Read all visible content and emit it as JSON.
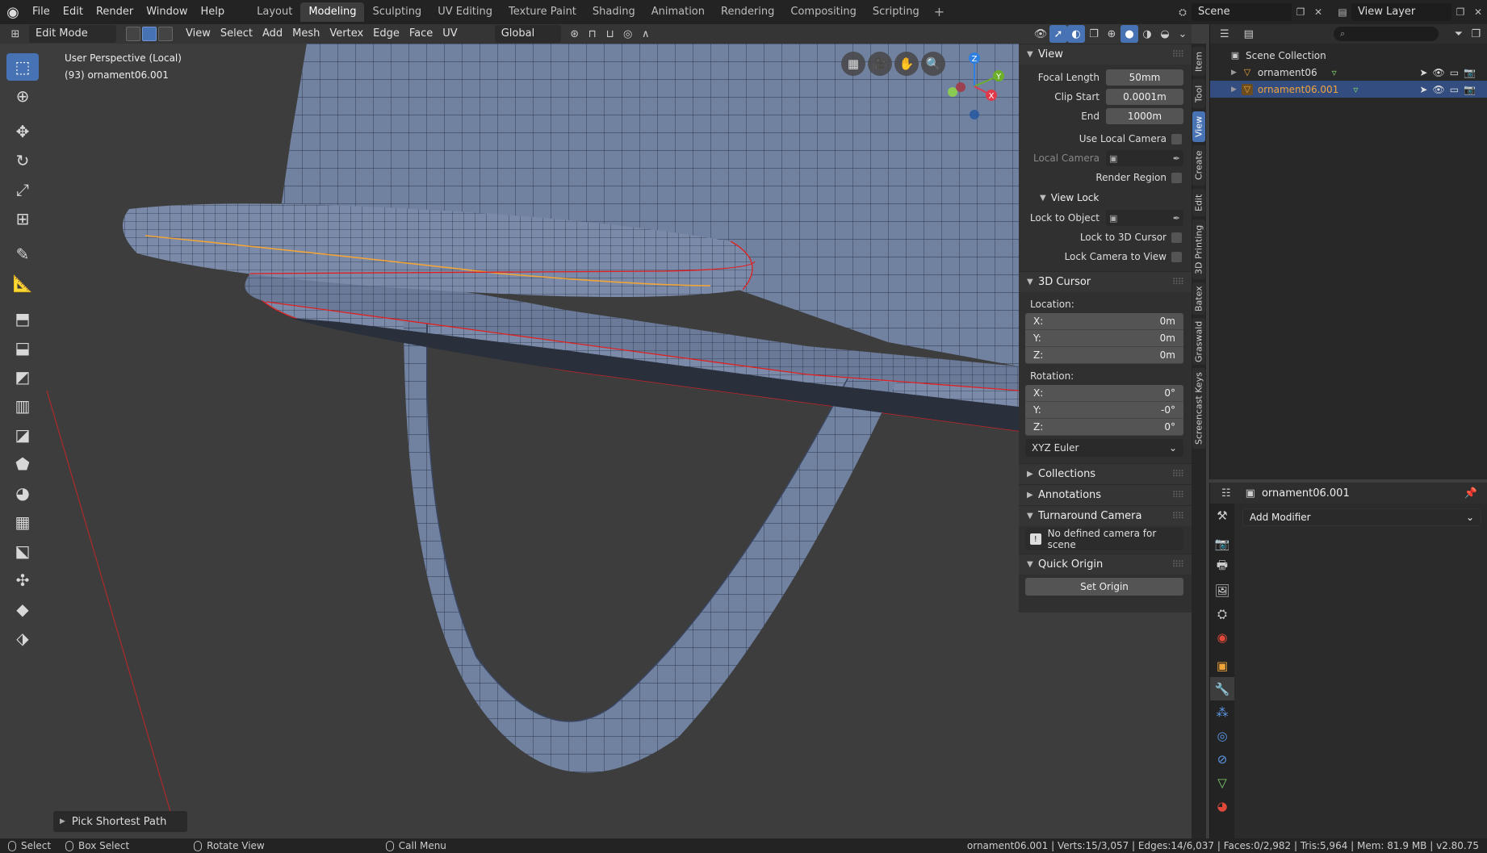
{
  "menus": [
    "File",
    "Edit",
    "Render",
    "Window",
    "Help"
  ],
  "workspaces": [
    "Layout",
    "Modeling",
    "Sculpting",
    "UV Editing",
    "Texture Paint",
    "Shading",
    "Animation",
    "Rendering",
    "Compositing",
    "Scripting"
  ],
  "active_workspace": "Modeling",
  "scene": "Scene",
  "view_layer": "View Layer",
  "header": {
    "mode": "Edit Mode",
    "menus": [
      "View",
      "Select",
      "Add",
      "Mesh",
      "Vertex",
      "Edge",
      "Face",
      "UV"
    ],
    "transform_orientation": "Global"
  },
  "viewport": {
    "perspective": "User Perspective (Local)",
    "object_info": "(93) ornament06.001",
    "last_operator": "Pick Shortest Path"
  },
  "gizmo": {
    "x": "X",
    "y": "Y",
    "z": "Z"
  },
  "npanel": {
    "view": {
      "title": "View",
      "focal_length_label": "Focal Length",
      "focal_length": "50mm",
      "clip_start_label": "Clip Start",
      "clip_start": "0.0001m",
      "end_label": "End",
      "end": "1000m",
      "use_local_camera": "Use Local Camera",
      "local_camera": "Local Camera",
      "render_region": "Render Region",
      "view_lock": "View Lock",
      "lock_to_object": "Lock to Object",
      "lock_to_3d_cursor": "Lock to 3D Cursor",
      "lock_camera_to_view": "Lock Camera to View"
    },
    "cursor": {
      "title": "3D Cursor",
      "location_label": "Location:",
      "loc": [
        {
          "axis": "X:",
          "value": "0m"
        },
        {
          "axis": "Y:",
          "value": "0m"
        },
        {
          "axis": "Z:",
          "value": "0m"
        }
      ],
      "rotation_label": "Rotation:",
      "rot": [
        {
          "axis": "X:",
          "value": "0°"
        },
        {
          "axis": "Y:",
          "value": "-0°"
        },
        {
          "axis": "Z:",
          "value": "0°"
        }
      ],
      "rotation_mode": "XYZ Euler"
    },
    "collections": "Collections",
    "annotations": "Annotations",
    "turnaround": {
      "title": "Turnaround Camera",
      "message": "No defined camera for scene"
    },
    "quick_origin": {
      "title": "Quick Origin",
      "button": "Set Origin"
    }
  },
  "side_tabs": [
    "Item",
    "Tool",
    "View",
    "Create",
    "Edit",
    "3D Printing",
    "Batex",
    "Graswald",
    "Screencast Keys"
  ],
  "active_side_tab": "View",
  "outliner": {
    "root": "Scene Collection",
    "items": [
      {
        "name": "ornament06",
        "selected": false
      },
      {
        "name": "ornament06.001",
        "selected": true
      }
    ]
  },
  "properties": {
    "object": "ornament06.001",
    "add_modifier": "Add Modifier",
    "tab_icons": [
      "tool-icon",
      "render-icon",
      "output-icon",
      "view-layer-icon",
      "scene-icon",
      "world-icon",
      "object-icon",
      "modifier-icon",
      "particles-icon",
      "physics-icon",
      "constraints-icon",
      "data-icon",
      "material-icon"
    ],
    "active_tab": "modifier-icon"
  },
  "status": {
    "select": "Select",
    "box_select": "Box Select",
    "rotate_view": "Rotate View",
    "call_menu": "Call Menu",
    "stats": "ornament06.001 | Verts:15/3,057 | Edges:14/6,037 | Faces:0/2,982 | Tris:5,964 | Mem: 81.9 MB | v2.80.75"
  },
  "colors": {
    "accent": "#4772b3",
    "mesh": "#7182a1",
    "selected_edge": "#f0a43a",
    "seam": "#e02020",
    "outliner_selected": "#f0a43a"
  }
}
